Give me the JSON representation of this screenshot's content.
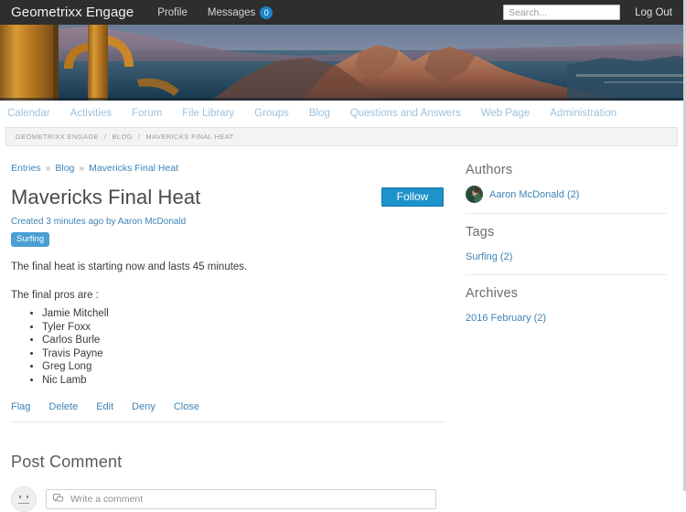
{
  "topbar": {
    "brand": "Geometrixx Engage",
    "nav": [
      {
        "label": "Profile"
      },
      {
        "label": "Messages",
        "badge": "0"
      }
    ],
    "search_placeholder": "Search...",
    "logout_label": "Log Out"
  },
  "mainnav": {
    "items": [
      {
        "label": "Calendar"
      },
      {
        "label": "Activities"
      },
      {
        "label": "Forum"
      },
      {
        "label": "File Library"
      },
      {
        "label": "Groups"
      },
      {
        "label": "Blog"
      },
      {
        "label": "Questions and Answers"
      },
      {
        "label": "Web Page"
      },
      {
        "label": "Administration"
      }
    ]
  },
  "breadcrumb": {
    "items": [
      {
        "label": "GEOMETRIXX ENGAGE"
      },
      {
        "label": "BLOG"
      },
      {
        "label": "MAVERICKS FINAL HEAT"
      }
    ],
    "separator": "/"
  },
  "entry": {
    "crumbs": [
      {
        "label": "Entries"
      },
      {
        "label": "Blog"
      },
      {
        "label": "Mavericks Final Heat"
      }
    ],
    "crumb_separator": "»",
    "title": "Mavericks Final Heat",
    "follow_label": "Follow",
    "meta": "Created 3 minutes ago by Aaron McDonald",
    "tag": "Surfing",
    "intro": "The final heat is starting now and lasts 45 minutes.",
    "list_intro": "The final pros are :",
    "pros": [
      "Jamie Mitchell",
      "Tyler Foxx",
      "Carlos Burle",
      "Travis Payne",
      "Greg Long",
      "Nic Lamb"
    ],
    "actions": [
      {
        "label": "Flag"
      },
      {
        "label": "Delete"
      },
      {
        "label": "Edit"
      },
      {
        "label": "Deny"
      },
      {
        "label": "Close"
      }
    ]
  },
  "comments": {
    "heading": "Post Comment",
    "placeholder": "Write a comment"
  },
  "sidebar": {
    "authors": {
      "heading": "Authors",
      "items": [
        {
          "label": "Aaron McDonald (2)"
        }
      ]
    },
    "tags": {
      "heading": "Tags",
      "items": [
        {
          "label": "Surfing (2)"
        }
      ]
    },
    "archives": {
      "heading": "Archives",
      "items": [
        {
          "label": "2016 February (2)"
        }
      ]
    }
  },
  "colors": {
    "topbar_bg": "#2e2e2e",
    "accent_blue": "#1d93cc",
    "link_blue": "#3f83b5",
    "nav_blue": "#9dc2de",
    "badge_blue": "#1d84c8",
    "tag_blue": "#4a9fd4"
  }
}
